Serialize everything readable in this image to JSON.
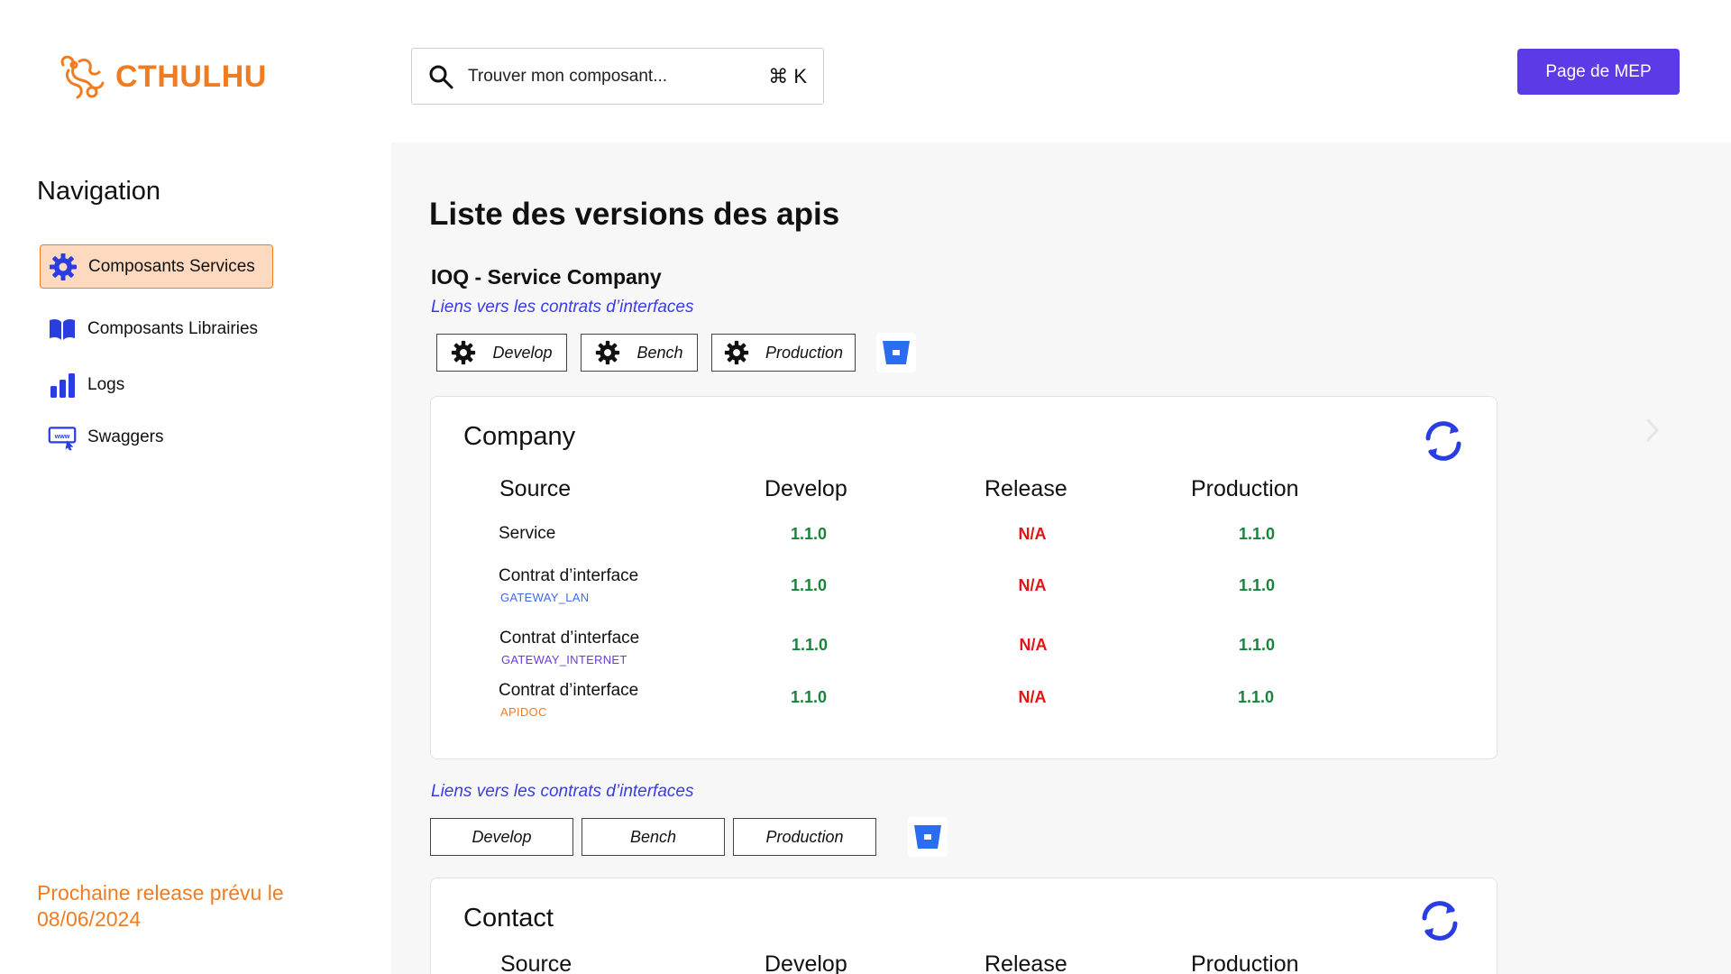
{
  "header": {
    "logo_text": "CTHULHU",
    "search_placeholder": "Trouver mon composant...",
    "search_shortcut": "⌘ K",
    "mep_button": "Page de MEP"
  },
  "sidebar": {
    "title": "Navigation",
    "items": [
      {
        "label": "Composants Services",
        "icon": "gear-icon",
        "active": true
      },
      {
        "label": "Composants Librairies",
        "icon": "book-icon",
        "active": false
      },
      {
        "label": "Logs",
        "icon": "bar-chart-icon",
        "active": false
      },
      {
        "label": "Swaggers",
        "icon": "www-icon",
        "active": false
      }
    ],
    "release_note": "Prochaine release prévu le 08/06/2024"
  },
  "main": {
    "title": "Liste des versions des apis",
    "service_title": "IOQ - Service Company",
    "links_label": "Liens vers les contrats d’interfaces",
    "env_buttons": [
      "Develop",
      "Bench",
      "Production"
    ],
    "cards": [
      {
        "title": "Company",
        "columns": [
          "Source",
          "Develop",
          "Release",
          "Production"
        ],
        "rows": [
          {
            "label": "Service",
            "sub": "",
            "develop": "1.1.0",
            "release": "N/A",
            "production": "1.1.0"
          },
          {
            "label": "Contrat d’interface",
            "sub": "GATEWAY_LAN",
            "develop": "1.1.0",
            "release": "N/A",
            "production": "1.1.0"
          },
          {
            "label": "Contrat d’interface",
            "sub": "GATEWAY_INTERNET",
            "develop": "1.1.0",
            "release": "N/A",
            "production": "1.1.0"
          },
          {
            "label": "Contrat d’interface",
            "sub": "APIDOC",
            "develop": "1.1.0",
            "release": "N/A",
            "production": "1.1.0"
          }
        ]
      },
      {
        "title": "Contact",
        "columns": [
          "Source",
          "Develop",
          "Release",
          "Production"
        ]
      }
    ],
    "second_links_label": "Liens vers les contrats d’interfaces",
    "second_env_buttons": [
      "Develop",
      "Bench",
      "Production"
    ]
  },
  "colors": {
    "accent_orange": "#f07c22",
    "primary_purple": "#5c3ae6",
    "link_blue": "#3b3be8",
    "icon_blue": "#2a3de0",
    "ok_green": "#17843a",
    "na_red": "#e21414",
    "sub_blue": "#3b6be8",
    "sub_purple": "#6a3ae6",
    "sub_orange": "#f07c22"
  }
}
